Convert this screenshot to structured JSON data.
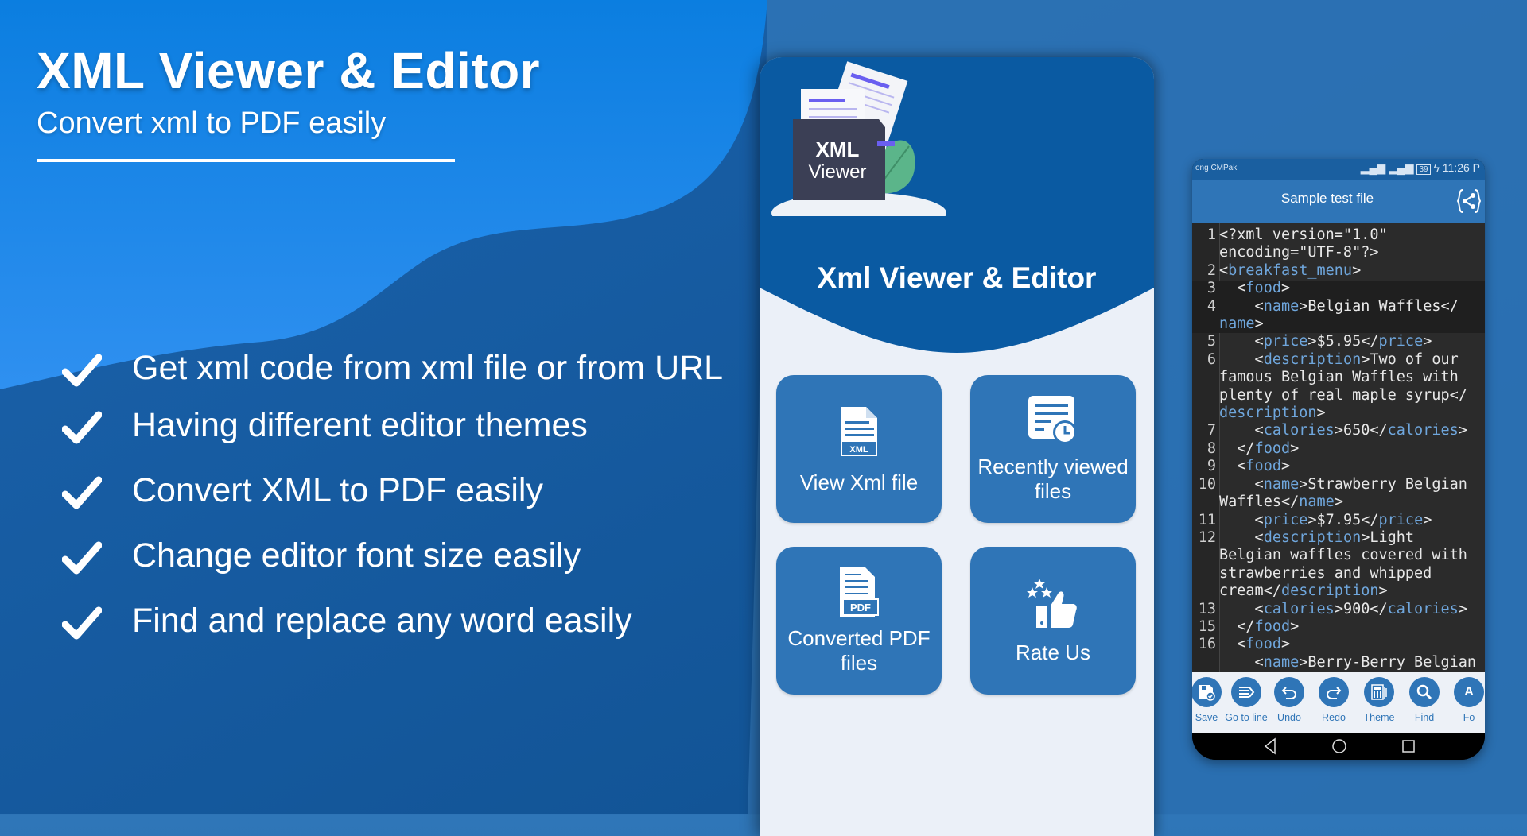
{
  "hero": {
    "title": "XML Viewer & Editor",
    "subtitle": "Convert xml to PDF easily"
  },
  "features": [
    {
      "icon": "checkmark-icon",
      "text": "Get xml code from xml file or from URL"
    },
    {
      "icon": "checkmark-icon",
      "text": "Having different editor themes"
    },
    {
      "icon": "checkmark-icon",
      "text": "Convert XML to PDF easily"
    },
    {
      "icon": "checkmark-icon",
      "text": "Change editor font size easily"
    },
    {
      "icon": "checkmark-icon",
      "text": "Find and replace any word easily"
    }
  ],
  "home_screen": {
    "logo": {
      "line1": "XML",
      "line2": "Viewer"
    },
    "app_title": "Xml Viewer & Editor",
    "cards": [
      {
        "icon": "xml-file-icon",
        "label": "View Xml file"
      },
      {
        "icon": "recent-files-icon",
        "label": "Recently viewed files"
      },
      {
        "icon": "pdf-file-icon",
        "label": "Converted PDF files"
      },
      {
        "icon": "rate-thumbs-up-icon",
        "label": "Rate Us"
      }
    ]
  },
  "editor_screen": {
    "status_bar": {
      "carrier": "ong CMPak",
      "battery": "39",
      "time": "11:26 P"
    },
    "title": "Sample test file",
    "share_icon": "xml-share-icon",
    "code_lines": [
      {
        "n": "1",
        "parts": [
          [
            "t",
            "<?xml version=\"1.0\""
          ]
        ]
      },
      {
        "n": "",
        "parts": [
          [
            "t",
            "encoding=\"UTF-8\"?>"
          ]
        ]
      },
      {
        "n": "2",
        "parts": [
          [
            "t",
            "<"
          ],
          [
            "g",
            "breakfast_menu"
          ],
          [
            "t",
            ">"
          ]
        ]
      },
      {
        "n": "3",
        "parts": [
          [
            "t",
            "  <"
          ],
          [
            "g",
            "food"
          ],
          [
            "t",
            ">"
          ]
        ]
      },
      {
        "n": "4",
        "parts": [
          [
            "t",
            "    <"
          ],
          [
            "g",
            "name"
          ],
          [
            "t",
            ">Belgian "
          ],
          [
            "u",
            "Waffles"
          ],
          [
            "t",
            "</"
          ]
        ]
      },
      {
        "n": "",
        "parts": [
          [
            "g",
            "name"
          ],
          [
            "t",
            ">"
          ]
        ]
      },
      {
        "n": "5",
        "parts": [
          [
            "t",
            "    <"
          ],
          [
            "g",
            "price"
          ],
          [
            "t",
            ">$5.95</"
          ],
          [
            "g",
            "price"
          ],
          [
            "t",
            ">"
          ]
        ]
      },
      {
        "n": "6",
        "parts": [
          [
            "t",
            "    <"
          ],
          [
            "g",
            "description"
          ],
          [
            "t",
            ">Two of our"
          ]
        ]
      },
      {
        "n": "",
        "parts": [
          [
            "t",
            "famous Belgian Waffles with"
          ]
        ]
      },
      {
        "n": "",
        "parts": [
          [
            "t",
            "plenty of real maple syrup</"
          ]
        ]
      },
      {
        "n": "",
        "parts": [
          [
            "g",
            "description"
          ],
          [
            "t",
            ">"
          ]
        ]
      },
      {
        "n": "7",
        "parts": [
          [
            "t",
            "    <"
          ],
          [
            "g",
            "calories"
          ],
          [
            "t",
            ">650</"
          ],
          [
            "g",
            "calories"
          ],
          [
            "t",
            ">"
          ]
        ]
      },
      {
        "n": "8",
        "parts": [
          [
            "t",
            "  </"
          ],
          [
            "g",
            "food"
          ],
          [
            "t",
            ">"
          ]
        ]
      },
      {
        "n": "9",
        "parts": [
          [
            "t",
            "  <"
          ],
          [
            "g",
            "food"
          ],
          [
            "t",
            ">"
          ]
        ]
      },
      {
        "n": "10",
        "parts": [
          [
            "t",
            "    <"
          ],
          [
            "g",
            "name"
          ],
          [
            "t",
            ">Strawberry Belgian"
          ]
        ]
      },
      {
        "n": "",
        "parts": [
          [
            "t",
            "Waffles</"
          ],
          [
            "g",
            "name"
          ],
          [
            "t",
            ">"
          ]
        ]
      },
      {
        "n": "11",
        "parts": [
          [
            "t",
            "    <"
          ],
          [
            "g",
            "price"
          ],
          [
            "t",
            ">$7.95</"
          ],
          [
            "g",
            "price"
          ],
          [
            "t",
            ">"
          ]
        ]
      },
      {
        "n": "12",
        "parts": [
          [
            "t",
            "    <"
          ],
          [
            "g",
            "description"
          ],
          [
            "t",
            ">Light"
          ]
        ]
      },
      {
        "n": "",
        "parts": [
          [
            "t",
            "Belgian waffles covered with"
          ]
        ]
      },
      {
        "n": "",
        "parts": [
          [
            "t",
            "strawberries and whipped"
          ]
        ]
      },
      {
        "n": "",
        "parts": [
          [
            "t",
            "cream</"
          ],
          [
            "g",
            "description"
          ],
          [
            "t",
            ">"
          ]
        ]
      },
      {
        "n": "13",
        "parts": [
          [
            "t",
            "    <"
          ],
          [
            "g",
            "calories"
          ],
          [
            "t",
            ">900</"
          ],
          [
            "g",
            "calories"
          ],
          [
            "t",
            ">"
          ]
        ]
      },
      {
        "n": "15",
        "parts": [
          [
            "t",
            "  </"
          ],
          [
            "g",
            "food"
          ],
          [
            "t",
            ">"
          ]
        ]
      },
      {
        "n": "16",
        "parts": [
          [
            "t",
            "  <"
          ],
          [
            "g",
            "food"
          ],
          [
            "t",
            ">"
          ]
        ]
      },
      {
        "n": "",
        "parts": [
          [
            "t",
            "    <"
          ],
          [
            "g",
            "name"
          ],
          [
            "t",
            ">Berry-Berry Belgian"
          ]
        ]
      }
    ],
    "toolbar": [
      {
        "icon": "save-icon",
        "label": "Save"
      },
      {
        "icon": "go-to-line-icon",
        "label": "Go to line"
      },
      {
        "icon": "undo-icon",
        "label": "Undo"
      },
      {
        "icon": "redo-icon",
        "label": "Redo"
      },
      {
        "icon": "theme-icon",
        "label": "Theme"
      },
      {
        "icon": "find-icon",
        "label": "Find"
      },
      {
        "icon": "font-icon",
        "label": "Fo"
      }
    ],
    "nav": [
      "back-icon",
      "home-icon",
      "recents-icon"
    ]
  },
  "colors": {
    "accent": "#2f75b7",
    "header_blue": "#0a5aa2",
    "code_bg": "#2b2b2b",
    "tag": "#6fa6dc",
    "bright_blue": "#1a8ef0"
  }
}
